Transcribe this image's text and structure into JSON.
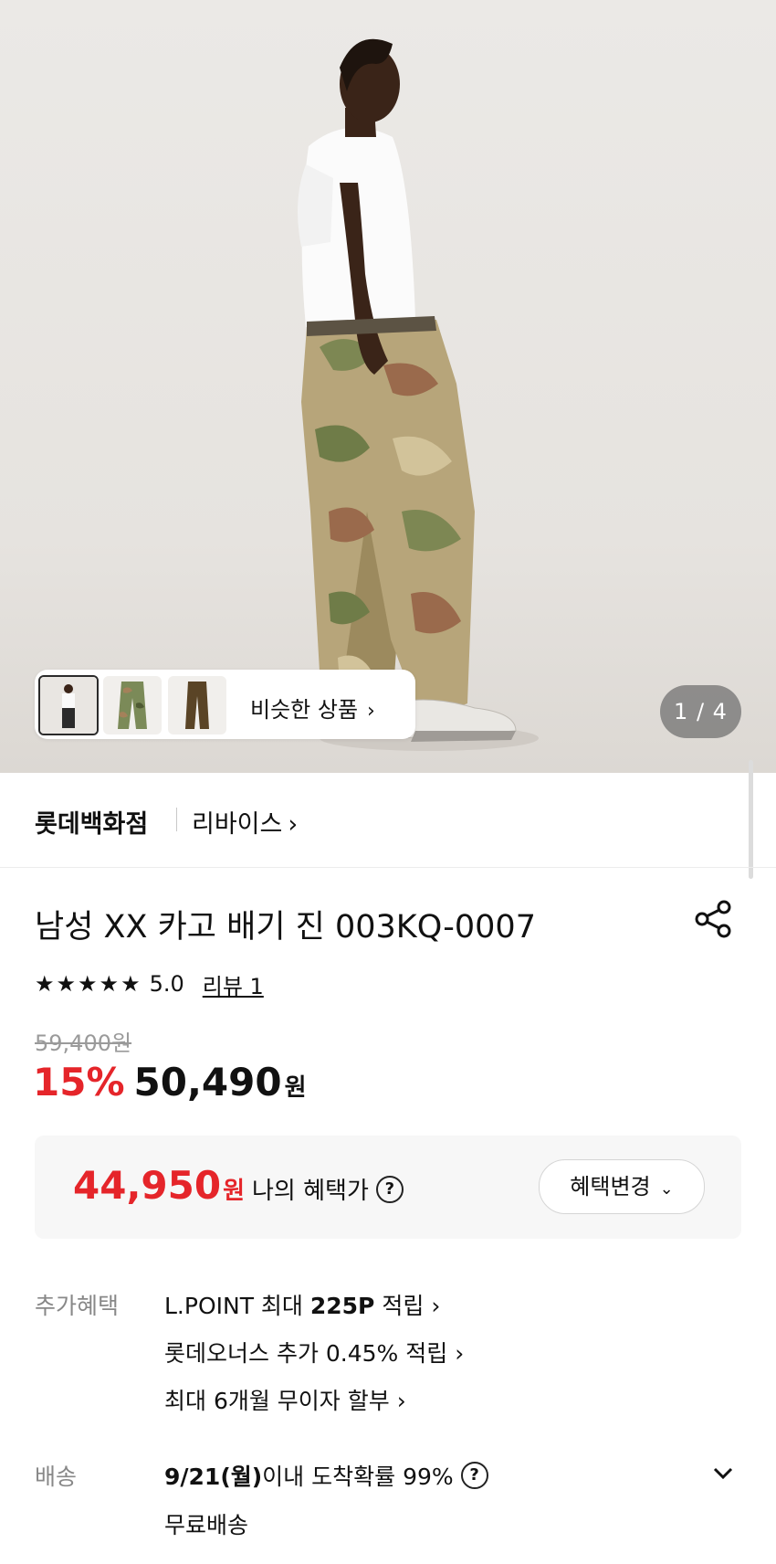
{
  "hero": {
    "page_indicator": "1 / 4",
    "similar_products_label": "비슷한 상품"
  },
  "store": {
    "name": "롯데백화점",
    "brand": "리바이스"
  },
  "product": {
    "title": "남성 XX 카고 배기 진 003KQ-0007",
    "rating_stars": "★★★★★",
    "rating_score": "5.0",
    "review_link": "리뷰 1"
  },
  "price": {
    "original": "59,400원",
    "discount_percent": "15%",
    "sale_price": "50,490",
    "currency": "원"
  },
  "benefit": {
    "price": "44,950",
    "currency": "원",
    "label": "나의 혜택가",
    "change_button": "혜택변경"
  },
  "additional_benefits": {
    "label": "추가혜택",
    "items": [
      {
        "prefix": "L.POINT 최대 ",
        "bold": "225P",
        "suffix": " 적립"
      },
      {
        "prefix": "롯데오너스 추가 0.45% 적립",
        "bold": "",
        "suffix": ""
      },
      {
        "prefix": "최대 6개월 무이자 할부",
        "bold": "",
        "suffix": ""
      }
    ]
  },
  "shipping": {
    "label": "배송",
    "date": "9/21(월)",
    "arrival_text": " 이내 도착확률 99%",
    "fee": "무료배송"
  },
  "colors": {
    "accent_red": "#e5252a",
    "pager_bg": "#6e6e6e"
  }
}
